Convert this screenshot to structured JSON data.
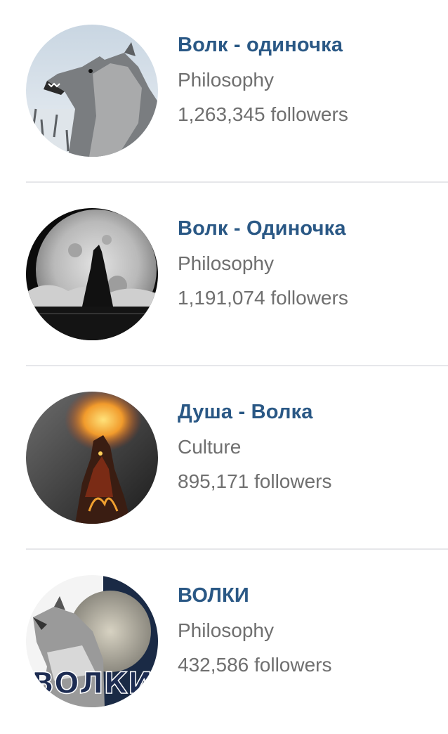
{
  "communities": [
    {
      "name": "Волк - одиночка",
      "category": "Philosophy",
      "followers": "1,263,345 followers",
      "avatar_icon": "howling-wolf-snow-avatar"
    },
    {
      "name": "Волк - Одиночка",
      "category": "Philosophy",
      "followers": "1,191,074 followers",
      "avatar_icon": "wolf-silhouette-moon-avatar"
    },
    {
      "name": "Душа - Волка",
      "category": "Culture",
      "followers": "895,171 followers",
      "avatar_icon": "fire-wolf-avatar"
    },
    {
      "name": "ВОЛКИ",
      "category": "Philosophy",
      "followers": "432,586 followers",
      "avatar_icon": "wolf-logo-avatar",
      "avatar_text": "ВОЛКИ"
    }
  ],
  "colors": {
    "name": "#2a5885",
    "secondary_text": "#6f6f6f",
    "divider": "#e6e7ea",
    "background": "#ffffff"
  }
}
